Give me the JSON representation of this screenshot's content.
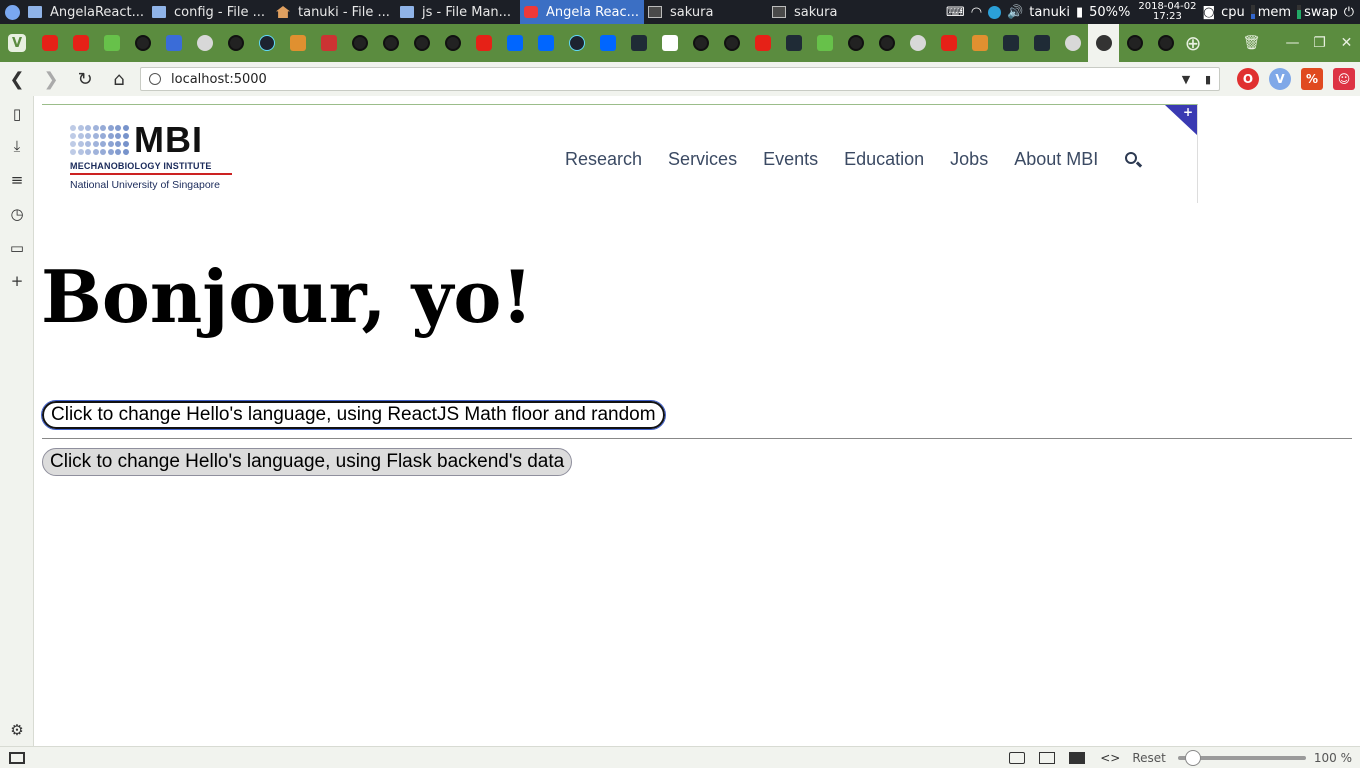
{
  "taskbar": {
    "tasks": [
      {
        "label": "AngelaReact...",
        "icon": "folder-icon"
      },
      {
        "label": "config - File ...",
        "icon": "folder-icon"
      },
      {
        "label": "tanuki - File ...",
        "icon": "home-folder-icon"
      },
      {
        "label": "js - File Man...",
        "icon": "folder-icon"
      },
      {
        "label": "Angela Reac...",
        "icon": "vivaldi-icon",
        "active": true
      },
      {
        "label": "sakura",
        "icon": "terminal-icon"
      },
      {
        "label": "sakura",
        "icon": "terminal-icon"
      }
    ],
    "tray": {
      "user": "tanuki",
      "battery": "50%%",
      "date": "2018-04-02",
      "time": "17:23",
      "cpu_label": "cpu",
      "mem_label": "mem",
      "swap_label": "swap"
    }
  },
  "browser": {
    "address": "localhost:5000",
    "zoom_reset_label": "Reset",
    "zoom_value": "100 %",
    "zoom_fraction": 0.12
  },
  "page": {
    "logo": {
      "mark": "MBI",
      "institute": "MECHANOBIOLOGY INSTITUTE",
      "university": "National University of Singapore"
    },
    "nav": [
      "Research",
      "Services",
      "Events",
      "Education",
      "Jobs",
      "About MBI"
    ],
    "greeting": "Bonjour, yo!",
    "button_random": "Click to change Hello's language, using ReactJS Math floor and random",
    "button_flask": "Click to change Hello's language, using Flask backend's data"
  },
  "colors": {
    "tabbar": "#5b8c3f",
    "taskbar": "#1c1f26",
    "active_task": "#3b6fc4",
    "nav_text": "#3b4a63",
    "corner_tab": "#3a3ab2"
  }
}
